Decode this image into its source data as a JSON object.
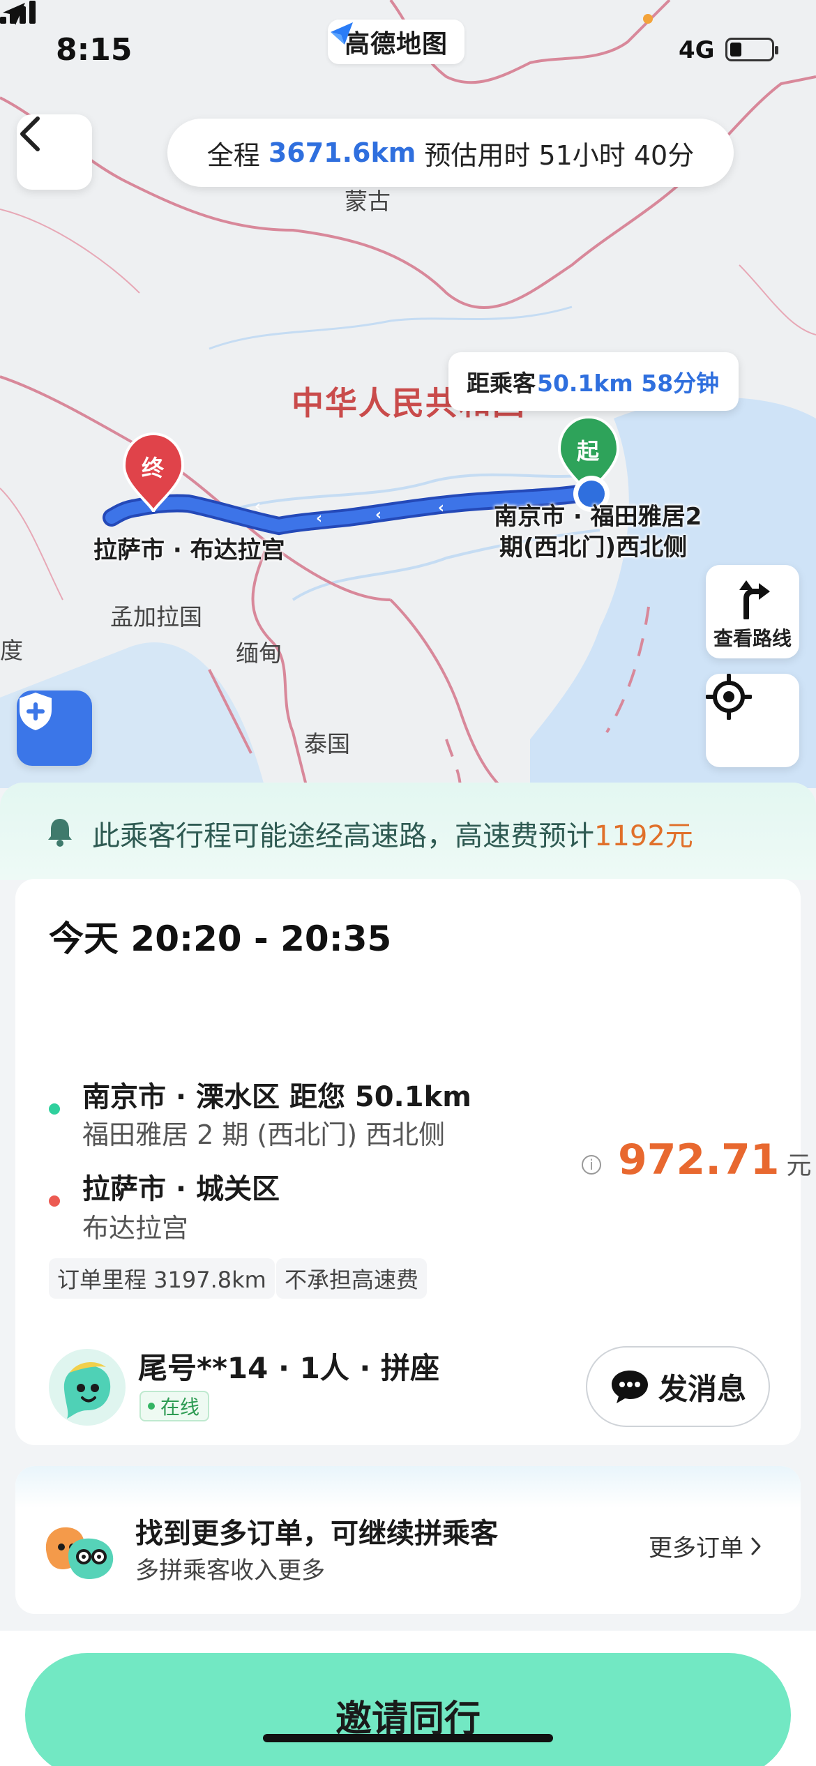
{
  "status_bar": {
    "time": "8:15",
    "network": "4G"
  },
  "app": {
    "name": "高德地图"
  },
  "route_summary": {
    "prefix": "全程",
    "distance": "3671.6km",
    "eta_text": "预估用时 51小时 40分"
  },
  "map": {
    "labels": {
      "mongolia": "蒙古",
      "china": "中华人民共和国",
      "bangladesh": "孟加拉国",
      "myanmar": "缅甸",
      "thailand": "泰国",
      "india_partial": "度"
    },
    "start_marker": "起",
    "end_marker": "终",
    "start_place": [
      "南京市 · 福田雅居2",
      "期(西北门)西北侧"
    ],
    "end_place": "拉萨市 · 布达拉宫",
    "distance_bubble": {
      "prefix": "距乘客",
      "value": "50.1km 58分钟"
    },
    "route_button_label": "查看路线",
    "colors": {
      "route": "#3d74e8",
      "border": "#d8889a",
      "water": "#cfe3f7"
    }
  },
  "notice": {
    "text": "此乘客行程可能途经高速路，高速费预计",
    "fee": "1192元"
  },
  "order": {
    "time": "今天 20:20 - 20:35",
    "pickup": {
      "title": "南京市 · 溧水区 距您 50.1km",
      "detail": "福田雅居 2 期 (西北门) 西北侧"
    },
    "dropoff": {
      "title": "拉萨市 · 城关区",
      "detail": "布达拉宫"
    },
    "price": {
      "amount": "972.71",
      "unit": "元"
    },
    "tags": [
      "订单里程 3197.8km",
      "不承担高速费"
    ],
    "passenger": {
      "name": "尾号**14 · 1人 · 拼座",
      "status": "在线"
    },
    "message_button": "发消息"
  },
  "more_orders": {
    "title": "找到更多订单，可继续拼乘客",
    "subtitle": "多拼乘客收入更多",
    "link": "更多订单"
  },
  "invite_button": "邀请同行",
  "colors": {
    "accent_green": "#72e8c3",
    "price_orange": "#e8682f",
    "link_blue": "#2f6fde"
  }
}
